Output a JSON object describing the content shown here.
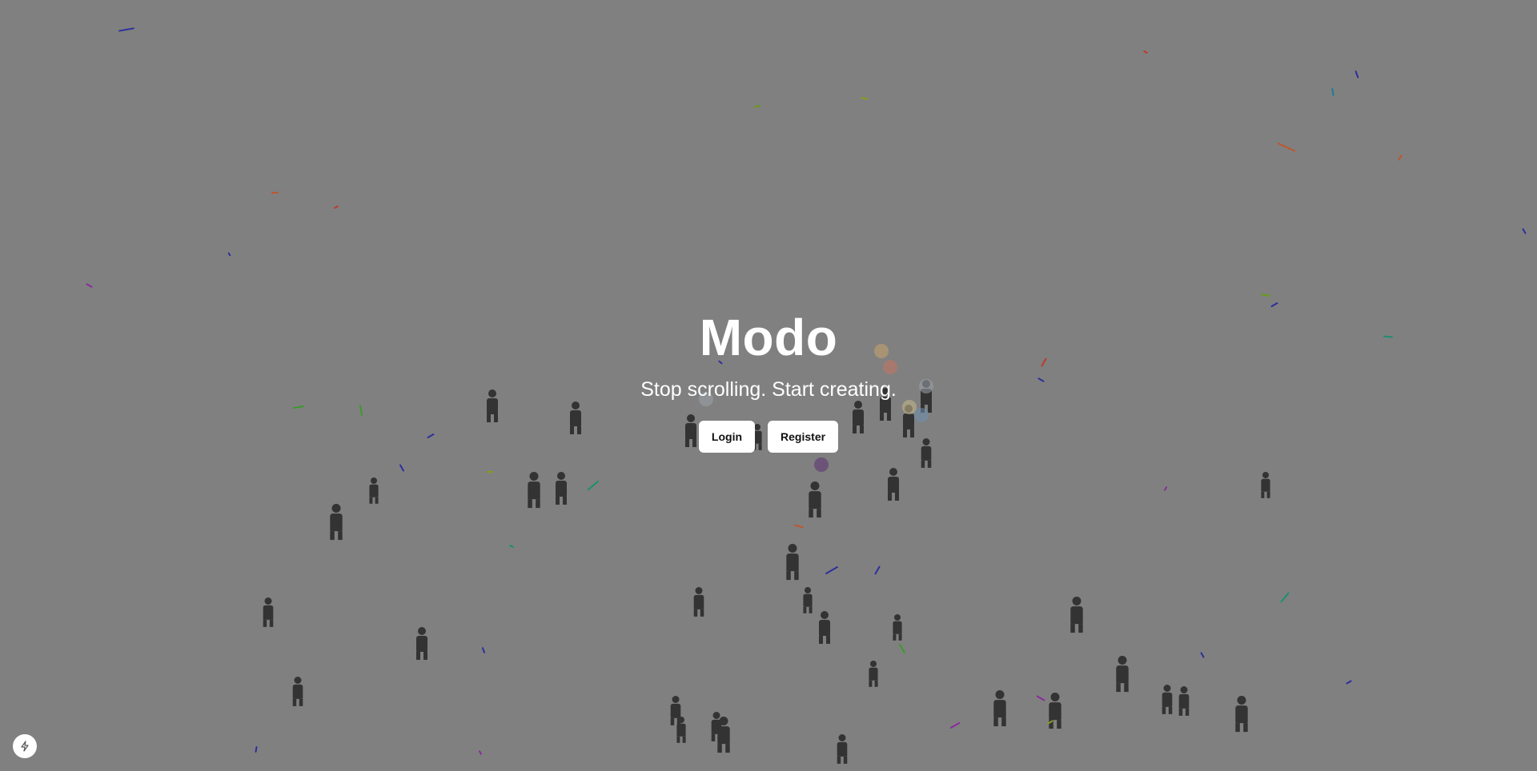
{
  "app": {
    "title": "Modo",
    "tagline": "Stop scrolling. Start creating."
  },
  "actions": {
    "login_label": "Login",
    "register_label": "Register"
  },
  "corner_button": {
    "icon": "lightning-bolt-icon"
  },
  "colors": {
    "background": "#808080",
    "figure": "#333333",
    "button_bg": "#ffffff",
    "button_text": "#111111",
    "title_text": "#ffffff"
  }
}
